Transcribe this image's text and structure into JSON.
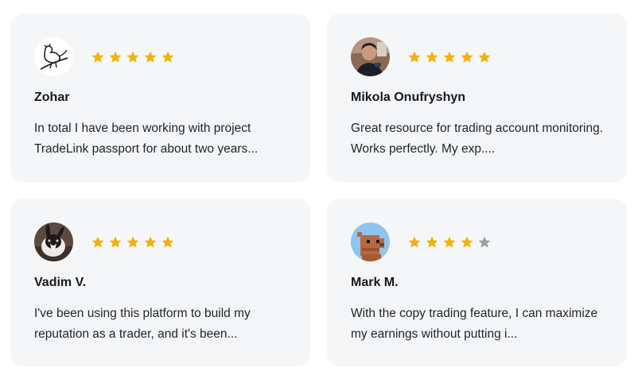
{
  "colors": {
    "star_filled": "#f2b10f",
    "star_empty": "#9aa1ab",
    "card_bg": "#f5f6f8"
  },
  "reviews": [
    {
      "name": "Zohar",
      "rating": 5,
      "avatar_icon": "bird-sketch-avatar",
      "text": "In total I have been working with project TradeLink passport for about two years..."
    },
    {
      "name": "Mikola Onufryshyn",
      "rating": 5,
      "avatar_icon": "person-photo-avatar",
      "text": "Great resource for trading account monitoring. Works perfectly. My exp...."
    },
    {
      "name": "Vadim V.",
      "rating": 5,
      "avatar_icon": "rabbit-photo-avatar",
      "text": "I've been using this platform to build my reputation as a trader, and it's been..."
    },
    {
      "name": "Mark M.",
      "rating": 4,
      "avatar_icon": "pixel-capybara-avatar",
      "text": "With the copy trading feature, I can maximize my earnings without putting i..."
    }
  ]
}
